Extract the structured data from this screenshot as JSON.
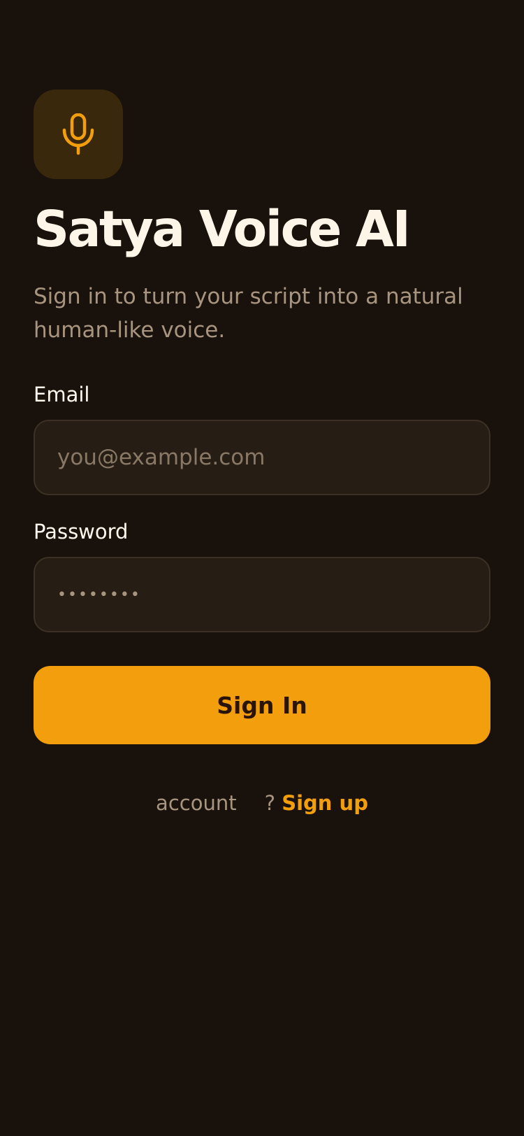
{
  "app": {
    "title": "Satya Voice AI",
    "subtitle": "Sign in to turn your script into a natural human-like voice.",
    "logo_icon": "microphone-icon"
  },
  "form": {
    "email": {
      "label": "Email",
      "placeholder": "you@example.com",
      "value": ""
    },
    "password": {
      "label": "Password",
      "placeholder": "••••••••",
      "value": ""
    },
    "submit_label": "Sign In"
  },
  "footer": {
    "prompt_word": "account",
    "question_mark": "?",
    "signup_link": "Sign up"
  },
  "colors": {
    "background": "#19110b",
    "accent": "#f39e0c",
    "logo_bg": "#3a280d",
    "field_bg": "#261e15",
    "field_border": "#3c3124",
    "muted_text": "#a89580",
    "primary_text": "#fdf6e8"
  }
}
